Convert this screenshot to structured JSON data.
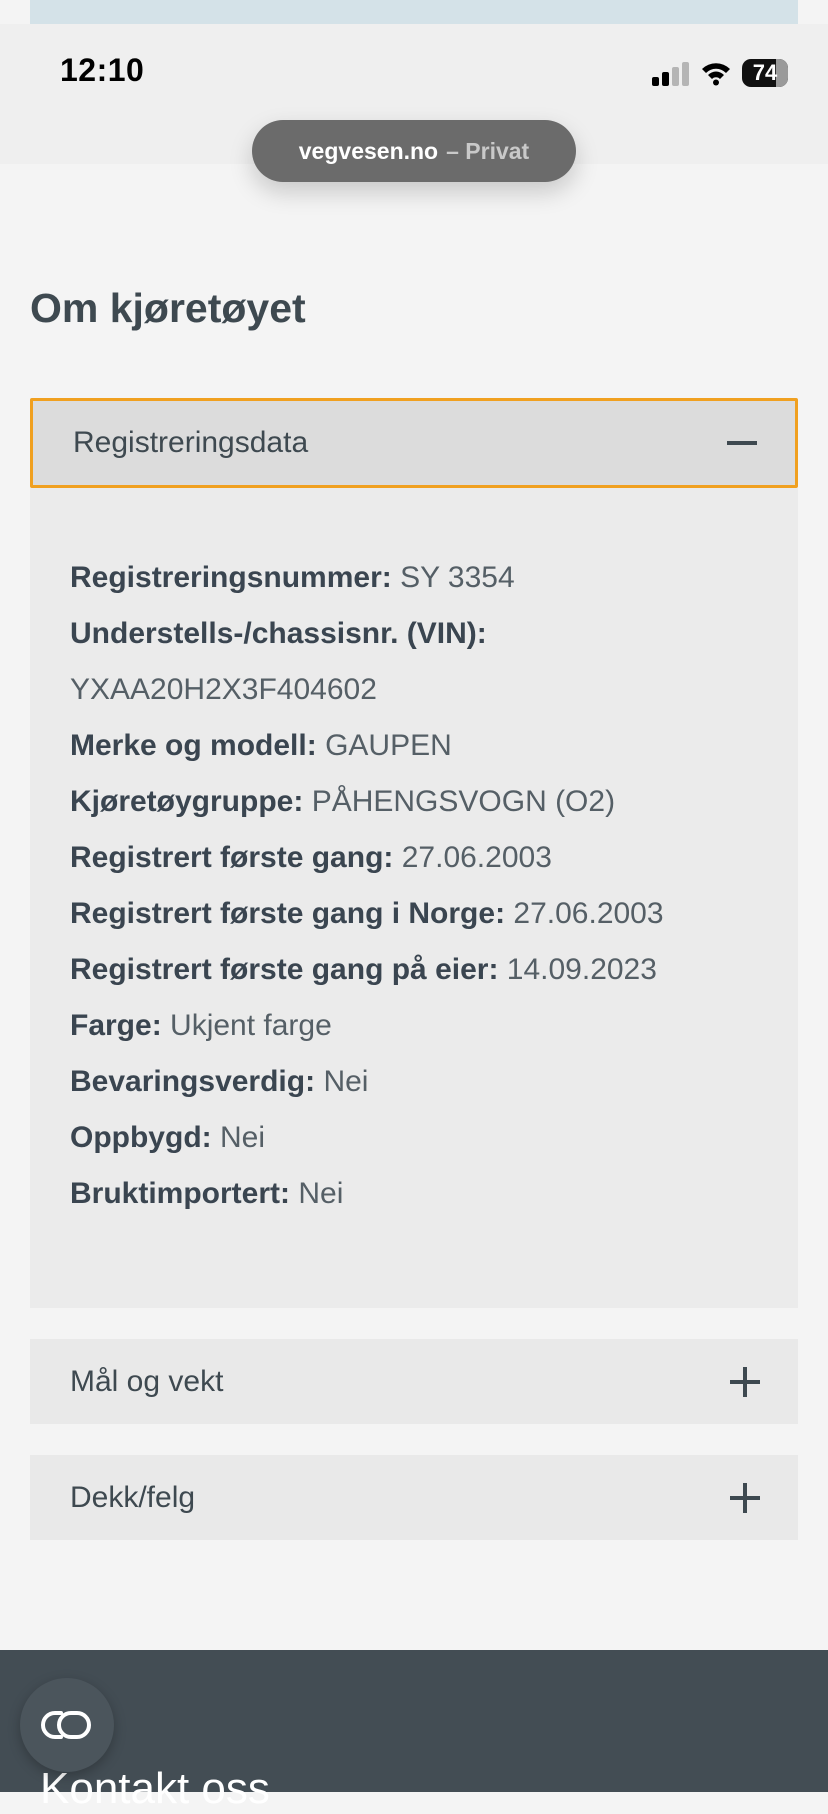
{
  "status_bar": {
    "time": "12:10",
    "battery": "74",
    "battery_level": 0.74
  },
  "browser": {
    "domain": "vegvesen.no",
    "mode": "– Privat"
  },
  "page": {
    "title": "Om kjøretøyet"
  },
  "accordion": {
    "open_section": {
      "label": "Registreringsdata",
      "rows": [
        {
          "label": "Registreringsnummer:",
          "value": "SY 3354"
        },
        {
          "label": "Understells-/chassisnr. (VIN):",
          "value": ""
        },
        {
          "label": "",
          "value": "YXAA20H2X3F404602"
        },
        {
          "label": "Merke og modell:",
          "value": "GAUPEN"
        },
        {
          "label": "Kjøretøygruppe:",
          "value": "PÅHENGSVOGN (O2)"
        },
        {
          "label": "Registrert første gang:",
          "value": "27.06.2003"
        },
        {
          "label": "Registrert første gang i Norge:",
          "value": "27.06.2003"
        },
        {
          "label": "Registrert første gang på eier:",
          "value": "14.09.2023"
        },
        {
          "label": "Farge:",
          "value": "Ukjent farge"
        },
        {
          "label": "Bevaringsverdig:",
          "value": "Nei"
        },
        {
          "label": "Oppbygd:",
          "value": "Nei"
        },
        {
          "label": "Bruktimportert:",
          "value": "Nei"
        }
      ]
    },
    "collapsed_sections": [
      {
        "label": "Mål og vekt"
      },
      {
        "label": "Dekk/felg"
      }
    ]
  },
  "footer": {
    "title": "Kontakt oss"
  },
  "icons": {
    "expanded": "minus-icon",
    "collapsed": "plus-icon",
    "cobrowse": "cobrowse-icon"
  },
  "colors": {
    "focus_outline": "#f0a020",
    "footer_bg": "#434d54",
    "text": "#3e4950"
  }
}
